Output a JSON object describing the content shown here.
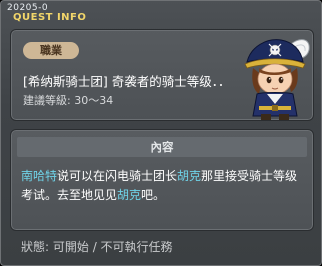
{
  "header": {
    "id": "20205-0",
    "title": "QUEST INFO"
  },
  "quest": {
    "class_badge": "職業",
    "name": "[希纳斯骑士团] 奇袭者的骑士等级．．",
    "level": "建議等級: 30～34"
  },
  "content": {
    "header": "內容",
    "npc1": "南哈特",
    "text1": "说可以在闪电骑士团长",
    "npc2": "胡克",
    "text2": "那里接受骑士等级考试。去至地见见",
    "npc3": "胡克",
    "text3": "吧。"
  },
  "status": {
    "label": "狀態",
    "value": ": 可開始 / 不可執行任務"
  },
  "colors": {
    "highlight": "#6fd3e8",
    "title": "#f2d66a",
    "badge": "#ceb796"
  }
}
